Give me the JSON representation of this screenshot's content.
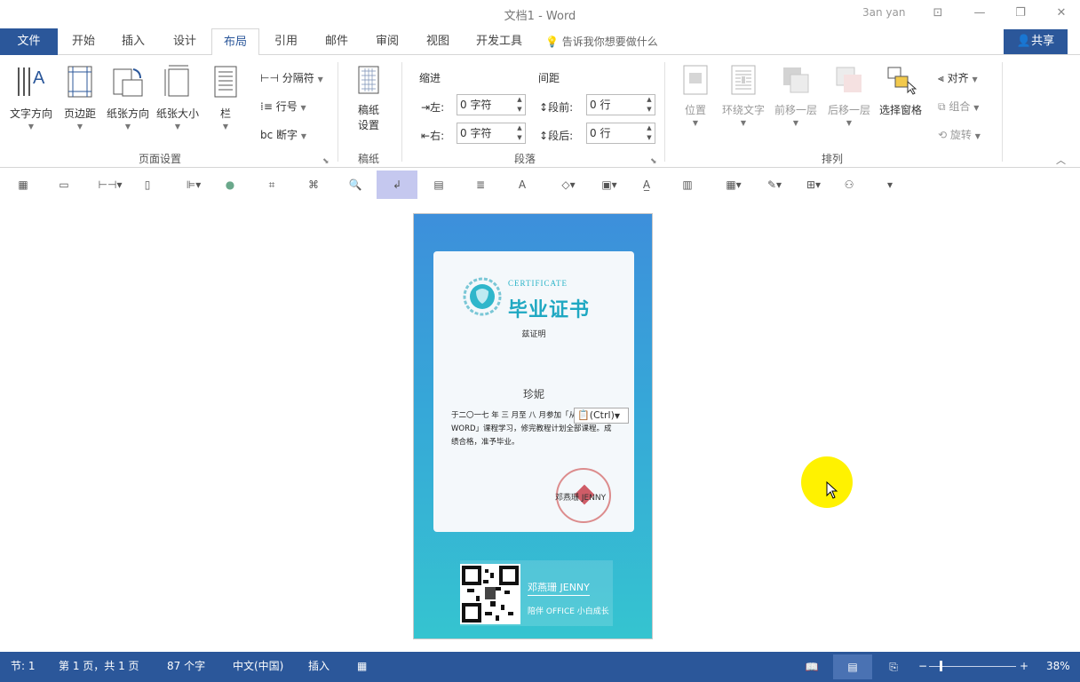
{
  "window": {
    "title": "文档1  -  Word",
    "user": "3an yan",
    "buttons": {
      "ribbon_display": "⊡",
      "minimize": "—",
      "restore": "❐",
      "close": "✕"
    }
  },
  "tabs": {
    "file": "文件",
    "items": [
      "开始",
      "插入",
      "设计",
      "布局",
      "引用",
      "邮件",
      "审阅",
      "视图",
      "开发工具"
    ],
    "active": "布局",
    "tell_me": "告诉我你想要做什么",
    "share": "共享"
  },
  "ribbon": {
    "page_setup": {
      "label": "页面设置",
      "text_direction": "文字方向",
      "margins": "页边距",
      "orientation": "纸张方向",
      "size": "纸张大小",
      "columns": "栏",
      "breaks": "分隔符",
      "line_numbers": "行号",
      "hyphenation": "断字"
    },
    "manuscript": {
      "label": "稿纸",
      "settings_line1": "稿纸",
      "settings_line2": "设置"
    },
    "paragraph": {
      "label": "段落",
      "indent": "缩进",
      "spacing": "间距",
      "left_label": "左:",
      "left_value": "0 字符",
      "right_label": "右:",
      "right_value": "0 字符",
      "before_label": "段前:",
      "before_value": "0 行",
      "after_label": "段后:",
      "after_value": "0 行"
    },
    "arrange": {
      "label": "排列",
      "position": "位置",
      "wrap_text": "环绕文字",
      "bring_forward": "前移一层",
      "send_backward": "后移一层",
      "selection_pane": "选择窗格",
      "align": "对齐",
      "group": "组合",
      "rotate": "旋转"
    }
  },
  "document": {
    "cert_en": "CERTIFICATE",
    "cert_title": "毕业证书",
    "cert_sub": "兹证明",
    "recipient": "珍妮",
    "body": "于二〇一七 年 三 月至 八 月参加「从零到精通 WORD」课程学习，修完教程计划全部课程。成绩合格，准予毕业。",
    "paste_options": "(Ctrl)",
    "signer": "邓燕珊 JENNY",
    "footer_name": "邓燕珊  JENNY",
    "footer_slogan": "陪伴 OFFICE 小白成长"
  },
  "statusbar": {
    "section": "节: 1",
    "page": "第 1 页，共 1 页",
    "words": "87 个字",
    "language": "中文(中国)",
    "mode": "插入",
    "zoom": "38%",
    "zoom_level": 38
  }
}
